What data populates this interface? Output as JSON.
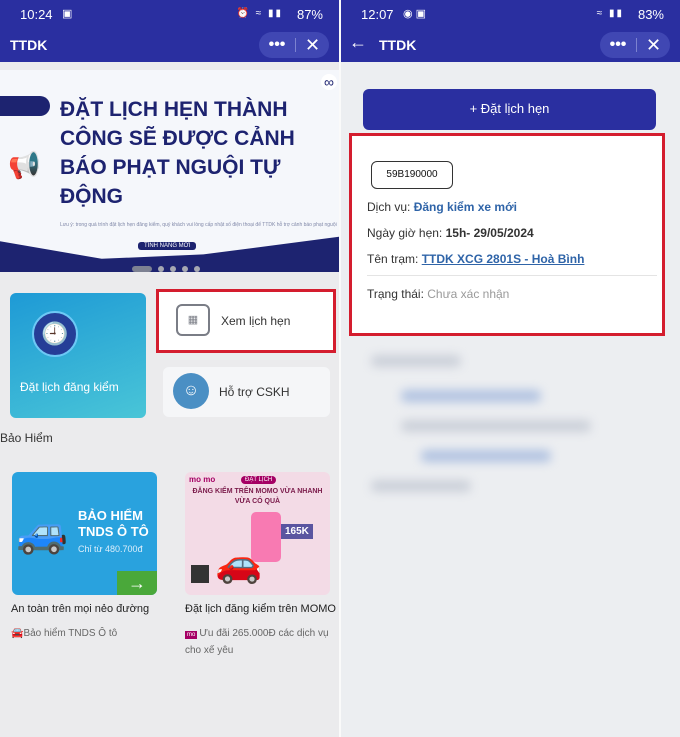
{
  "left": {
    "status": {
      "time": "10:24",
      "battery": "87%"
    },
    "appbar": {
      "title": "TTDK"
    },
    "banner": {
      "headline": "ĐẶT LỊCH HẸN THÀNH CÔNG SẼ ĐƯỢC CẢNH BÁO PHẠT NGUỘI TỰ ĐỘNG",
      "fine_print": "Lưu ý: trong quá trình đặt lịch hẹn đăng kiểm, quý khách vui lòng cấp nhật số điện thoại để TTDK hỗ trợ cảnh báo phạt nguội",
      "tag": "TÍNH NĂNG MỚI"
    },
    "tiles": {
      "book": "Đặt lịch đăng kiểm",
      "view": "Xem lịch hẹn",
      "support": "Hỗ trợ CSKH"
    },
    "section_title": "Bảo Hiểm",
    "insurance_card": {
      "title": "BẢO HIỂM TNDS Ô TÔ",
      "price": "Chỉ từ 480.700đ",
      "caption": "An toàn trên mọi nẻo đường",
      "sub": "Bảo hiểm TNDS Ô tô"
    },
    "momo_card": {
      "logo": "mo mo",
      "tag": "ĐẶT LỊCH",
      "headline": "ĐĂNG KIỂM TRÊN MOMO VỪA NHANH VỪA CÓ QUÀ",
      "badge": "165K",
      "caption": "Đặt lịch đăng kiểm trên MOMO",
      "sub": "Ưu đãi 265.000Đ các dịch vụ cho xế yêu"
    }
  },
  "right": {
    "status": {
      "time": "12:07",
      "battery": "83%"
    },
    "appbar": {
      "title": "TTDK"
    },
    "book_button": "+ Đặt lịch hẹn",
    "appointment": {
      "plate": "59B190000",
      "service_label": "Dịch vụ:",
      "service": "Đăng kiểm xe mới",
      "time_label": "Ngày giờ hẹn:",
      "time": "15h- 29/05/2024",
      "station_label": "Tên trạm:",
      "station": "TTDK XCG 2801S - Hoà Bình",
      "status_label": "Trạng thái:",
      "status": "Chưa xác nhận"
    }
  },
  "colors": {
    "primary": "#2a2fa0",
    "highlight": "#d41d2e",
    "link": "#2f64a8"
  }
}
